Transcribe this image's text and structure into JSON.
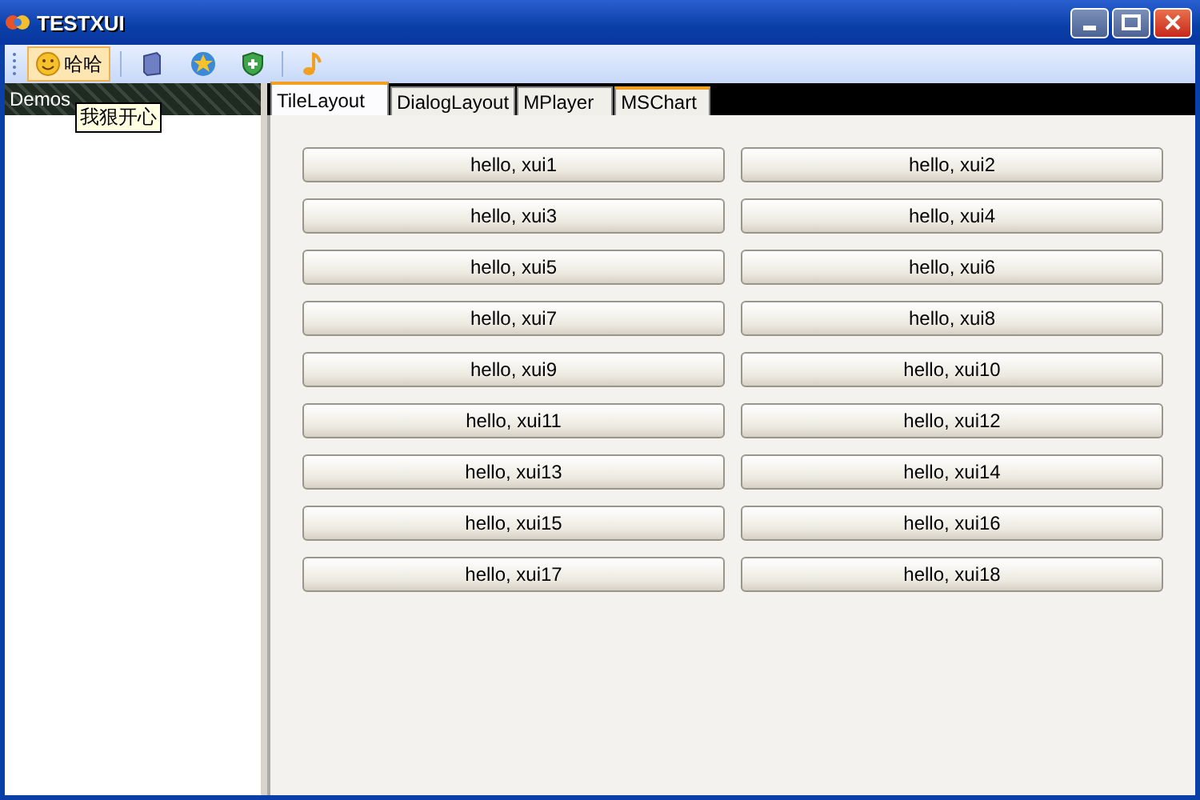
{
  "window": {
    "title": "TESTXUI"
  },
  "toolbar": [
    {
      "kind": "label",
      "label": "哈哈",
      "hovered": true
    },
    {
      "kind": "separator"
    },
    {
      "kind": "book"
    },
    {
      "kind": "star"
    },
    {
      "kind": "shield"
    },
    {
      "kind": "separator"
    },
    {
      "kind": "note"
    }
  ],
  "sidebar": {
    "title": "Demos",
    "tooltip": "我狠开心"
  },
  "tabs": [
    {
      "label": "TileLayout",
      "selected": true,
      "hovered": false
    },
    {
      "label": "DialogLayout",
      "selected": false,
      "hovered": false
    },
    {
      "label": "MPlayer",
      "selected": false,
      "hovered": false
    },
    {
      "label": "MSChart",
      "selected": false,
      "hovered": true
    }
  ],
  "buttons": [
    "hello, xui1",
    "hello, xui2",
    "hello, xui3",
    "hello, xui4",
    "hello, xui5",
    "hello, xui6",
    "hello, xui7",
    "hello, xui8",
    "hello, xui9",
    "hello, xui10",
    "hello, xui11",
    "hello, xui12",
    "hello, xui13",
    "hello, xui14",
    "hello, xui15",
    "hello, xui16",
    "hello, xui17",
    "hello, xui18"
  ]
}
